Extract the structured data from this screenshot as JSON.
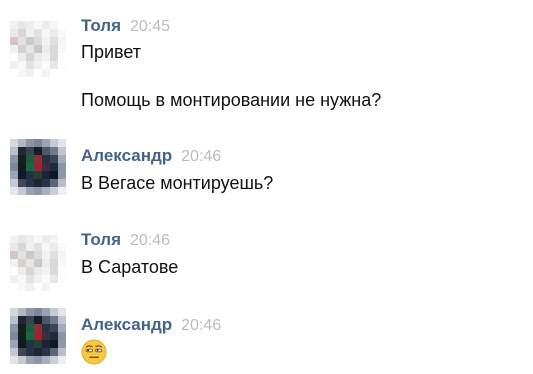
{
  "messages": [
    {
      "author": "Толя",
      "time": "20:45",
      "lines": [
        "Привет",
        "Помощь в монтировании не нужна?"
      ]
    },
    {
      "author": "Александр",
      "time": "20:46",
      "lines": [
        "В Вегасе монтируешь?"
      ]
    },
    {
      "author": "Толя",
      "time": "20:46",
      "lines": [
        "В Саратове"
      ]
    },
    {
      "author": "Александр",
      "time": "20:46",
      "emoji": "unamused-face-icon"
    }
  ],
  "colors": {
    "author": "#42648b",
    "time": "#b8bcc2",
    "text": "#111111",
    "emoji_face": "#f7c843"
  }
}
